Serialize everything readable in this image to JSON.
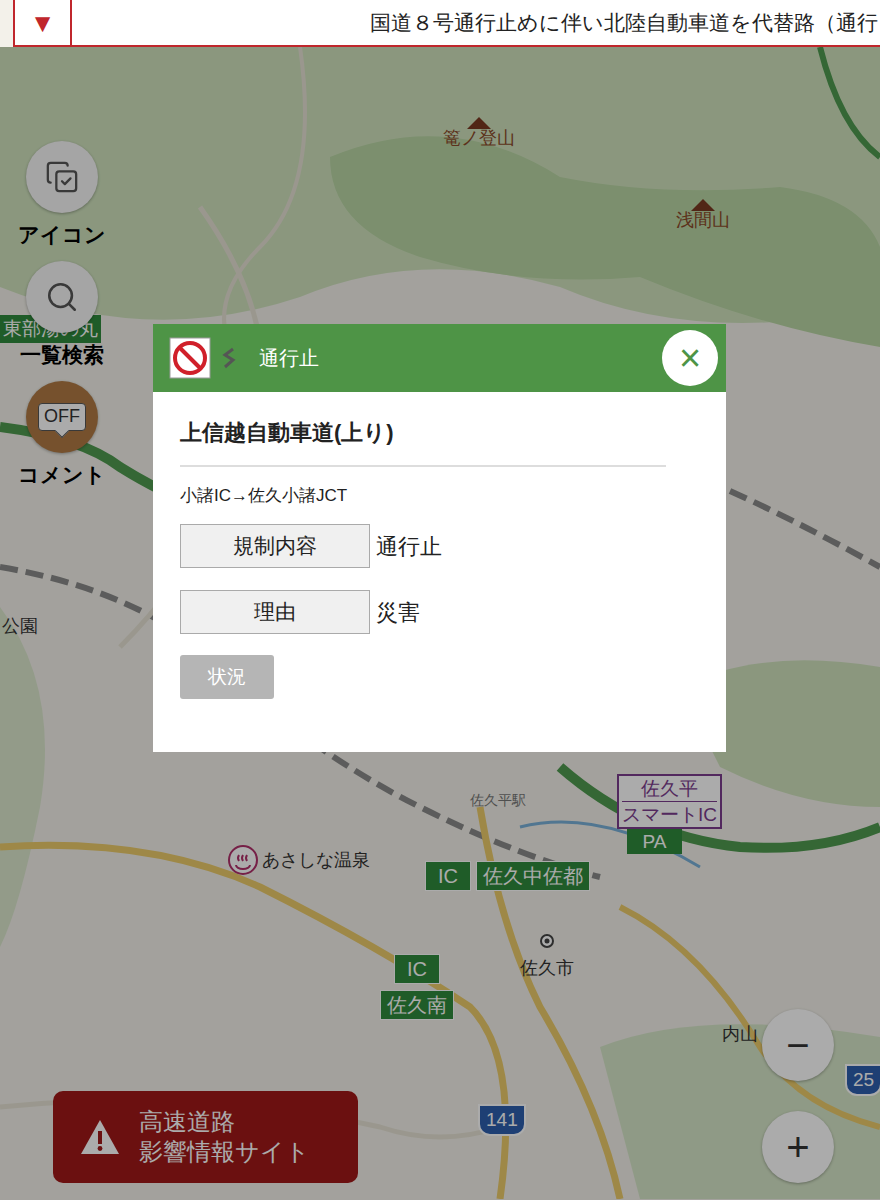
{
  "banner": {
    "toggle": "▼",
    "text": "国道８号通行止めに伴い北陸自動車道を代替路（通行"
  },
  "controls": [
    {
      "label": "アイコン",
      "kind": "icons"
    },
    {
      "label": "一覧検索",
      "kind": "search"
    },
    {
      "label": "コメント",
      "kind": "comment",
      "badge": "OFF",
      "on": false
    }
  ],
  "map": {
    "labels": [
      {
        "text": "篭ノ登山",
        "kind": "peak"
      },
      {
        "text": "浅間山",
        "kind": "peak"
      },
      {
        "text": "あさしな温泉",
        "kind": "onsen"
      },
      {
        "text": "佐久市",
        "kind": "city"
      },
      {
        "text": "内山",
        "kind": "place"
      },
      {
        "text": "佐久平駅",
        "kind": "station"
      },
      {
        "text": "公園",
        "kind": "place"
      }
    ],
    "highway_signs": [
      {
        "kind": "tag",
        "text": "東部湯の丸"
      },
      {
        "kind": "smart",
        "text": "佐久平",
        "sub": "スマートIC",
        "extra": "PA"
      },
      {
        "kind": "ic",
        "badge": "IC",
        "text": "佐久中佐都"
      },
      {
        "kind": "ic-stack",
        "badge": "IC",
        "text": "佐久南"
      }
    ],
    "route_shields": [
      "141",
      "25"
    ]
  },
  "dialog": {
    "header": "通行止",
    "close": "×",
    "title": "上信越自動車道(上り)",
    "section": "小諸IC→佐久小諸JCT",
    "rows": [
      {
        "label": "規制内容",
        "value": "通行止"
      },
      {
        "label": "理由",
        "value": "災害"
      }
    ],
    "button": {
      "label": "状況",
      "disabled": true
    }
  },
  "external_link": {
    "lines": [
      "高速道路",
      "影響情報サイト"
    ]
  },
  "zoom": {
    "out": "−",
    "in": "+"
  }
}
